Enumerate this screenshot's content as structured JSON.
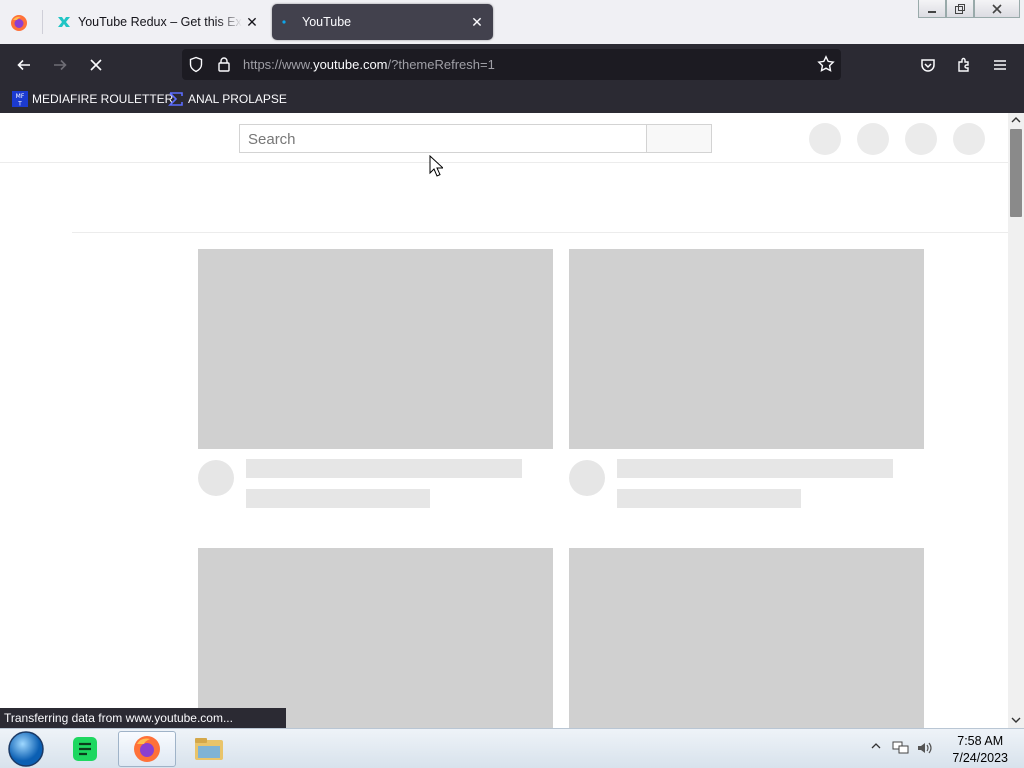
{
  "browser": {
    "tabs": [
      {
        "title": "YouTube Redux – Get this Extension for Firefox",
        "active": false
      },
      {
        "title": "YouTube",
        "active": true
      }
    ],
    "url_prefix": "https://www.",
    "url_host": "youtube.com",
    "url_path": "/?themeRefresh=1",
    "bookmarks": [
      {
        "label": "MEDIAFIRE ROULETTER",
        "icon": "mediafire-icon"
      },
      {
        "label": "ANAL PROLAPSE",
        "icon": "sigma-icon"
      }
    ],
    "status_text": "Transferring data from www.youtube.com..."
  },
  "page": {
    "search_placeholder": "Search"
  },
  "taskbar": {
    "time": "7:58 AM",
    "date": "7/24/2023"
  },
  "colors": {
    "toolbar": "#2b2a33",
    "urlbar": "#1c1b22",
    "skeleton": "#d0d0d0"
  }
}
